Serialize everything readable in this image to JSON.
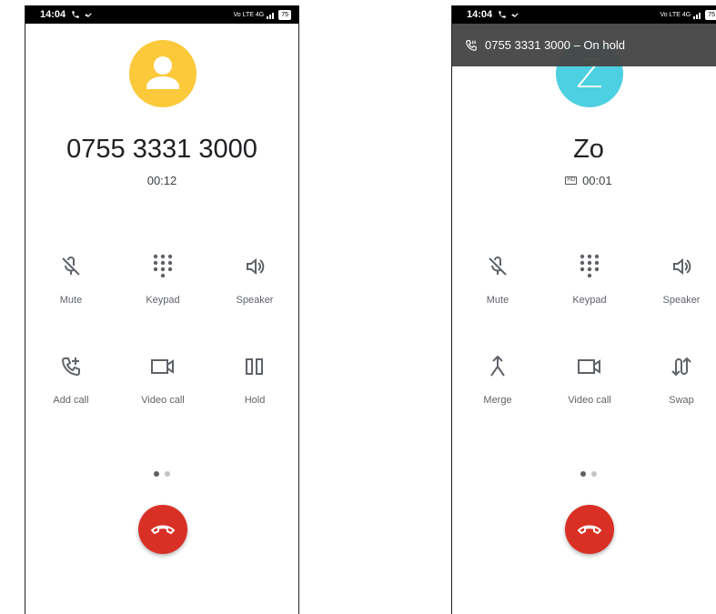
{
  "left": {
    "status": {
      "time": "14:04",
      "battery": "75",
      "network": "Vo LTE 4G"
    },
    "caller": "0755 3331 3000",
    "duration": "00:12",
    "buttons": [
      {
        "label": "Mute",
        "icon": "mic-off-icon"
      },
      {
        "label": "Keypad",
        "icon": "dialpad-icon"
      },
      {
        "label": "Speaker",
        "icon": "speaker-icon"
      },
      {
        "label": "Add call",
        "icon": "add-call-icon"
      },
      {
        "label": "Video call",
        "icon": "video-call-icon"
      },
      {
        "label": "Hold",
        "icon": "pause-icon"
      }
    ]
  },
  "right": {
    "status": {
      "time": "14:04",
      "battery": "75",
      "network": "Vo LTE 4G"
    },
    "banner": "0755 3331 3000 – On hold",
    "avatar_letter": "Z",
    "caller": "Zo",
    "hd": "HD",
    "duration": "00:01",
    "buttons": [
      {
        "label": "Mute",
        "icon": "mic-off-icon"
      },
      {
        "label": "Keypad",
        "icon": "dialpad-icon"
      },
      {
        "label": "Speaker",
        "icon": "speaker-icon"
      },
      {
        "label": "Merge",
        "icon": "merge-icon"
      },
      {
        "label": "Video call",
        "icon": "video-call-icon"
      },
      {
        "label": "Swap",
        "icon": "swap-icon"
      }
    ]
  },
  "colors": {
    "end_call": "#d93025",
    "avatar_left": "#fbc93a",
    "avatar_right": "#4dd0e1"
  }
}
